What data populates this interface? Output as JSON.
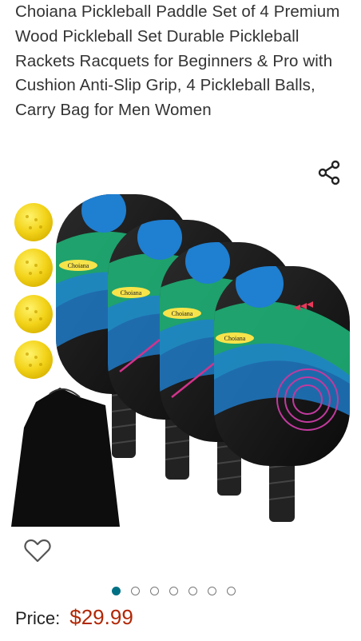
{
  "product": {
    "title": "Choiana Pickleball Paddle Set of 4 Premium Wood Pickleball Set Durable Pickleball Rackets Racquets for Beginners & Pro with Cushion Anti-Slip Grip, 4 Pickleball Balls, Carry Bag for Men Women",
    "paddle_brand_text": "Choiana",
    "price_label": "Price:",
    "price_value": "$29.99"
  },
  "carousel": {
    "total_images": 7,
    "active_index": 0
  },
  "icons": {
    "share": "share-icon",
    "favorite": "heart-icon"
  },
  "colors": {
    "price": "#b12704",
    "dot_active": "#007185",
    "ball_yellow": "#f5d81c",
    "paddle_green": "#1fb97a",
    "paddle_blue": "#1f7fd1"
  }
}
